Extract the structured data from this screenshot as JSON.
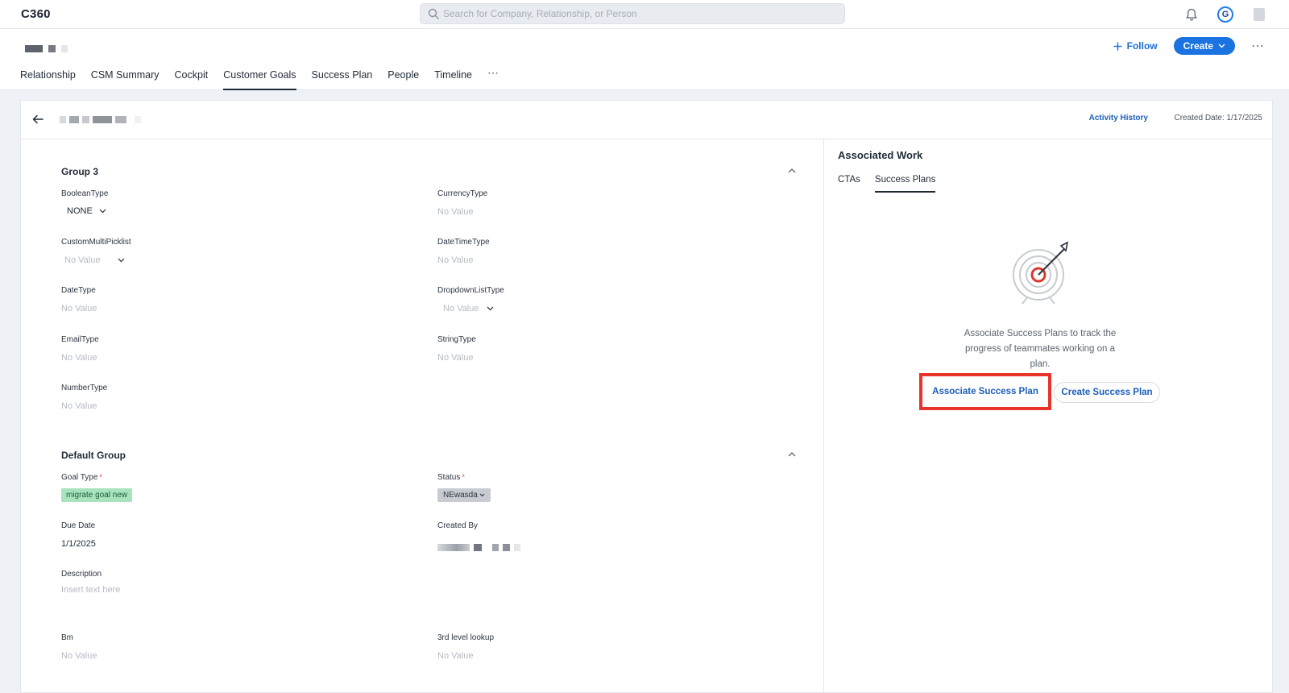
{
  "app": {
    "title": "C360"
  },
  "search": {
    "placeholder": "Search for Company, Relationship, or Person"
  },
  "header": {
    "follow_label": "Follow",
    "create_label": "Create",
    "more_label": "⋯"
  },
  "tabs": [
    {
      "label": "Relationship",
      "active": false
    },
    {
      "label": "CSM Summary",
      "active": false
    },
    {
      "label": "Cockpit",
      "active": false
    },
    {
      "label": "Customer Goals",
      "active": true
    },
    {
      "label": "Success Plan",
      "active": false
    },
    {
      "label": "People",
      "active": false
    },
    {
      "label": "Timeline",
      "active": false
    }
  ],
  "tabs_more": "⋯",
  "record": {
    "activity_history": "Activity History",
    "created_date": "Created Date: 1/17/2025"
  },
  "groups": {
    "group3": {
      "title": "Group 3",
      "boolean_label": "BooleanType",
      "boolean_value": "NONE",
      "currency_label": "CurrencyType",
      "currency_value": "No Value",
      "multipicklist_label": "CustomMultiPicklist",
      "multipicklist_value": "No Value",
      "datetime_label": "DateTimeType",
      "datetime_value": "No Value",
      "date_label": "DateType",
      "date_value": "No Value",
      "dropdown_label": "DropdownListType",
      "dropdown_value": "No Value",
      "email_label": "EmailType",
      "email_value": "No Value",
      "string_label": "StringType",
      "string_value": "No Value",
      "number_label": "NumberType",
      "number_value": "No Value"
    },
    "default": {
      "title": "Default Group",
      "goal_type_label": "Goal Type",
      "goal_type_value": "migrate goal new",
      "status_label": "Status",
      "status_value": "NEwasda",
      "required_mark": "*",
      "due_date_label": "Due Date",
      "due_date_value": "1/1/2025",
      "created_by_label": "Created By",
      "description_label": "Description",
      "description_placeholder": "Insert text here",
      "bm_label": "Bm",
      "bm_value": "No Value",
      "lookup_label": "3rd level lookup",
      "lookup_value": "No Value"
    }
  },
  "associated_work": {
    "title": "Associated Work",
    "tabs": [
      {
        "label": "CTAs",
        "active": false
      },
      {
        "label": "Success Plans",
        "active": true
      }
    ],
    "empty_message": "Associate Success Plans to track the progress of teammates working on a plan.",
    "associate_button": "Associate Success Plan",
    "create_button": "Create Success Plan",
    "highlight_color": "#e8342a"
  },
  "colors": {
    "primary": "#1a73e0",
    "link": "#1c5fb8",
    "goal_tag_bg": "#a8e3bd",
    "status_tag_bg": "#c8ccd2"
  }
}
